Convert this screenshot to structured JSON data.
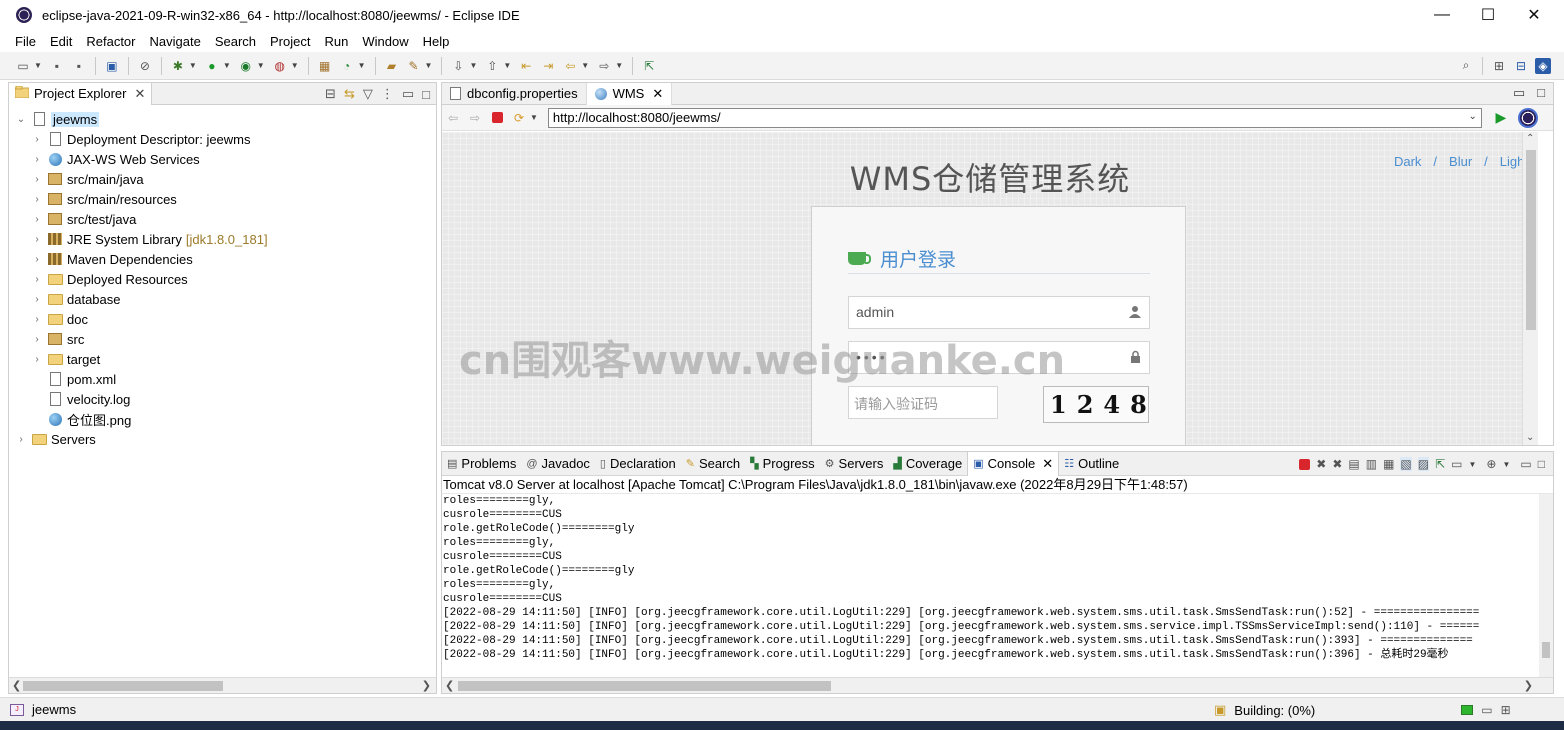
{
  "window": {
    "title": "eclipse-java-2021-09-R-win32-x86_64 - http://localhost:8080/jeewms/ - Eclipse IDE",
    "minimize": "—",
    "maximize": "☐",
    "close": "✕"
  },
  "menu": [
    "File",
    "Edit",
    "Refactor",
    "Navigate",
    "Search",
    "Project",
    "Run",
    "Window",
    "Help"
  ],
  "project_explorer": {
    "tab_label": "Project Explorer",
    "items": [
      {
        "label": "jeewms",
        "decoration": "",
        "level": 0,
        "icon": "project-icon",
        "expanded": true
      },
      {
        "label": "Deployment Descriptor: jeewms",
        "decoration": "",
        "level": 1,
        "icon": "descriptor-icon"
      },
      {
        "label": "JAX-WS Web Services",
        "decoration": "",
        "level": 1,
        "icon": "webservice-icon"
      },
      {
        "label": "src/main/java",
        "decoration": "",
        "level": 1,
        "icon": "package-icon"
      },
      {
        "label": "src/main/resources",
        "decoration": "",
        "level": 1,
        "icon": "package-icon"
      },
      {
        "label": "src/test/java",
        "decoration": "",
        "level": 1,
        "icon": "package-icon"
      },
      {
        "label": "JRE System Library",
        "decoration": "[jdk1.8.0_181]",
        "level": 1,
        "icon": "library-icon"
      },
      {
        "label": "Maven Dependencies",
        "decoration": "",
        "level": 1,
        "icon": "library-icon"
      },
      {
        "label": "Deployed Resources",
        "decoration": "",
        "level": 1,
        "icon": "folder-icon"
      },
      {
        "label": "database",
        "decoration": "",
        "level": 1,
        "icon": "folder-icon"
      },
      {
        "label": "doc",
        "decoration": "",
        "level": 1,
        "icon": "folder-icon"
      },
      {
        "label": "src",
        "decoration": "",
        "level": 1,
        "icon": "package-icon"
      },
      {
        "label": "target",
        "decoration": "",
        "level": 1,
        "icon": "folder-icon"
      },
      {
        "label": "pom.xml",
        "decoration": "",
        "level": 1,
        "icon": "xml-file-icon"
      },
      {
        "label": "velocity.log",
        "decoration": "",
        "level": 1,
        "icon": "file-icon"
      },
      {
        "label": "仓位图.png",
        "decoration": "",
        "level": 1,
        "icon": "image-file-icon"
      },
      {
        "label": "Servers",
        "decoration": "",
        "level": 0,
        "icon": "folder-icon"
      }
    ]
  },
  "editor": {
    "tabs": [
      {
        "label": "dbconfig.properties",
        "active": false
      },
      {
        "label": "WMS",
        "active": true
      }
    ],
    "url": "http://localhost:8080/jeewms/"
  },
  "web": {
    "title": "WMS仓储管理系统",
    "theme_links": [
      "Dark",
      "/",
      "Blur",
      "/",
      "Light"
    ],
    "login_heading": "用户登录",
    "username_value": "admin",
    "password_value": "••••",
    "captcha_placeholder": "请输入验证码",
    "captcha_text": "1248"
  },
  "watermark": "cn围观客www.weiguanke.cn",
  "bottom_panel": {
    "tabs": [
      "Problems",
      "Javadoc",
      "Declaration",
      "Search",
      "Progress",
      "Servers",
      "Coverage",
      "Console",
      "Outline"
    ],
    "active_tab": "Console",
    "console_header": "Tomcat v8.0 Server at localhost [Apache Tomcat] C:\\Program Files\\Java\\jdk1.8.0_181\\bin\\javaw.exe  (2022年8月29日下午1:48:57)",
    "console_lines": [
      "roles========gly,",
      "cusrole========CUS",
      "role.getRoleCode()========gly",
      "roles========gly,",
      "cusrole========CUS",
      "role.getRoleCode()========gly",
      "roles========gly,",
      "cusrole========CUS",
      "[2022-08-29 14:11:50] [INFO] [org.jeecgframework.core.util.LogUtil:229] [org.jeecgframework.web.system.sms.util.task.SmsSendTask:run():52] - ================",
      "[2022-08-29 14:11:50] [INFO] [org.jeecgframework.core.util.LogUtil:229] [org.jeecgframework.web.system.sms.service.impl.TSSmsServiceImpl:send():110] - ======",
      "[2022-08-29 14:11:50] [INFO] [org.jeecgframework.core.util.LogUtil:229] [org.jeecgframework.web.system.sms.util.task.SmsSendTask:run():393] - ==============",
      "[2022-08-29 14:11:50] [INFO] [org.jeecgframework.core.util.LogUtil:229] [org.jeecgframework.web.system.sms.util.task.SmsSendTask:run():396] - 总耗时29毫秒"
    ]
  },
  "status": {
    "selected": "jeewms",
    "building": "Building: (0%)"
  },
  "colors": {
    "accent": "#4a8ed0",
    "stop_red": "#d9262c",
    "run_green": "#1a9a2a"
  }
}
